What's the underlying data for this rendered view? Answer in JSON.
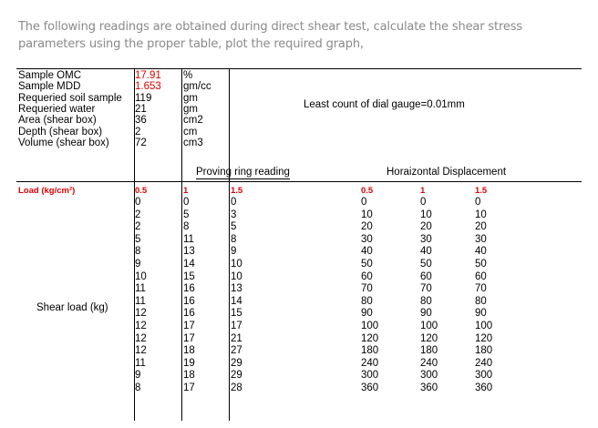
{
  "intro": "The following readings are obtained during direct shear test, calculate the shear stress parameters using the proper table, plot the required graph,",
  "params": [
    {
      "label": "Sample OMC",
      "value": "17.91",
      "unit": "%"
    },
    {
      "label": "Sample MDD",
      "value": "1.653",
      "unit": "gm/cc"
    },
    {
      "label": "Requeried soil sample",
      "value": "119",
      "unit": "gm"
    },
    {
      "label": "Requeried water",
      "value": "21",
      "unit": "gm"
    },
    {
      "label": "Area (shear box)",
      "value": "36",
      "unit": "cm2"
    },
    {
      "label": "Depth (shear box)",
      "value": "2",
      "unit": "cm"
    },
    {
      "label": "Volume (shear box)",
      "value": "72",
      "unit": "cm3"
    }
  ],
  "least_count": "Least count of dial gauge=0.01mm",
  "proving_ring_header": "Proving ring reading",
  "horizontal_header": "Horaizontal Displacement",
  "load_label": "Load (kg/cm²)",
  "loads": [
    "0.5",
    "1",
    "1.5"
  ],
  "shear_load_label": "Shear load (kg)",
  "rows": [
    [
      "0",
      "0",
      "0",
      "0",
      "0",
      "0"
    ],
    [
      "2",
      "5",
      "3",
      "10",
      "10",
      "10"
    ],
    [
      "2",
      "8",
      "5",
      "20",
      "20",
      "20"
    ],
    [
      "5",
      "11",
      "8",
      "30",
      "30",
      "30"
    ],
    [
      "8",
      "13",
      "9",
      "40",
      "40",
      "40"
    ],
    [
      "9",
      "14",
      "10",
      "50",
      "50",
      "50"
    ],
    [
      "10",
      "15",
      "10",
      "60",
      "60",
      "60"
    ],
    [
      "11",
      "16",
      "13",
      "70",
      "70",
      "70"
    ],
    [
      "11",
      "16",
      "14",
      "80",
      "80",
      "80"
    ],
    [
      "12",
      "16",
      "15",
      "90",
      "90",
      "90"
    ],
    [
      "12",
      "17",
      "17",
      "100",
      "100",
      "100"
    ],
    [
      "12",
      "17",
      "21",
      "120",
      "120",
      "120"
    ],
    [
      "12",
      "18",
      "27",
      "180",
      "180",
      "180"
    ],
    [
      "11",
      "19",
      "29",
      "240",
      "240",
      "240"
    ],
    [
      "9",
      "18",
      "29",
      "300",
      "300",
      "300"
    ],
    [
      "8",
      "17",
      "28",
      "360",
      "360",
      "360"
    ]
  ]
}
